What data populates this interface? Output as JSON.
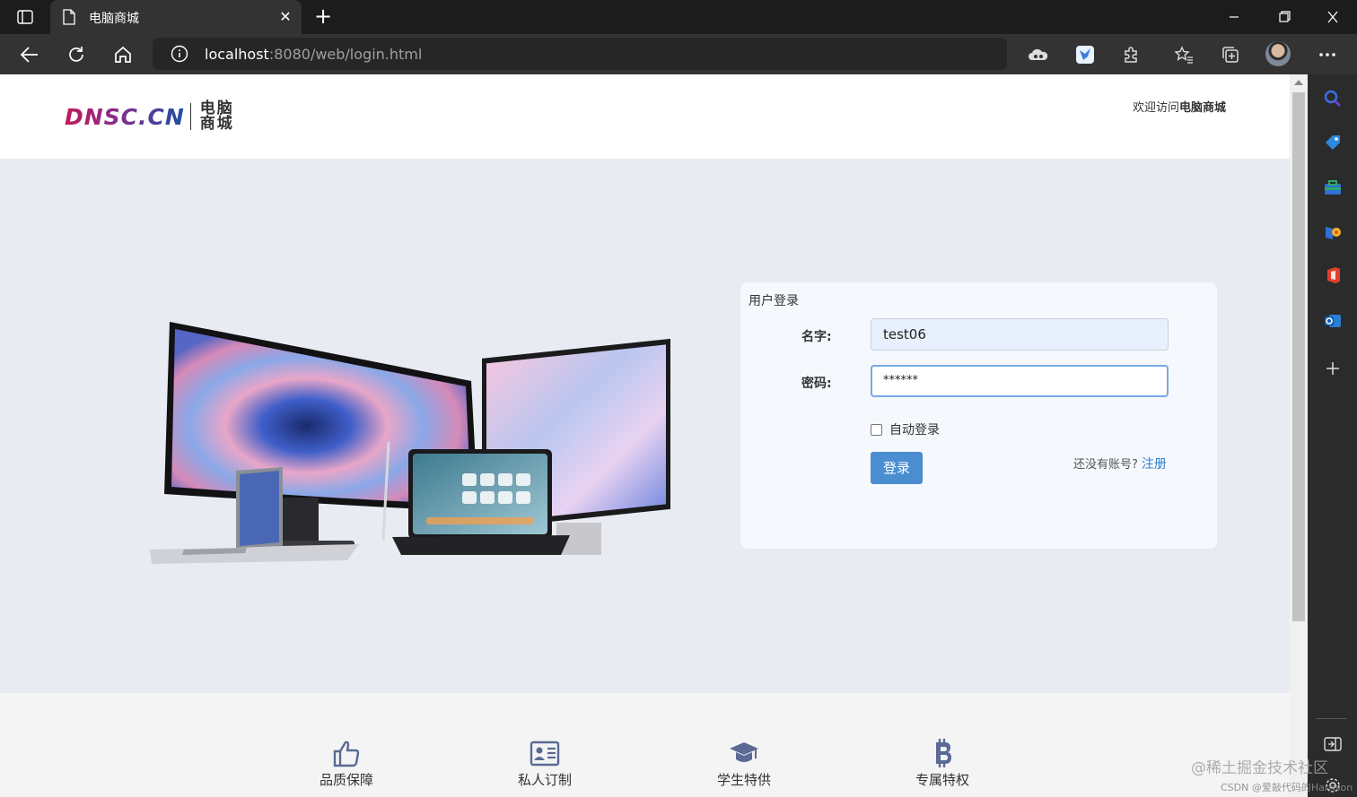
{
  "browser": {
    "tab_title": "电脑商城",
    "address_host": "localhost",
    "address_path": ":8080/web/login.html"
  },
  "header": {
    "logo_en": "DNSC.CN",
    "logo_cn": "电脑商城",
    "welcome_prefix": "欢迎访问",
    "welcome_name": "电脑商城"
  },
  "login": {
    "title": "用户登录",
    "username_label": "名字:",
    "username_value": "test06",
    "password_label": "密码:",
    "password_masked": "******",
    "remember_label": "自动登录",
    "login_button": "登录",
    "no_account_text": "还没有账号?",
    "register_link": "注册"
  },
  "features": [
    {
      "label": "品质保障",
      "icon": "thumbs-up-icon"
    },
    {
      "label": "私人订制",
      "icon": "id-card-icon"
    },
    {
      "label": "学生特供",
      "icon": "graduation-cap-icon"
    },
    {
      "label": "专属特权",
      "icon": "bitcoin-icon"
    }
  ],
  "watermark": {
    "main": "@稀土掘金技术社区",
    "sub": "CSDN @爱敲代码的Harrison"
  },
  "colors": {
    "accent": "#4a8ed1",
    "link": "#2f7fd0",
    "hero_bg": "#e8ecf2",
    "feature_icon": "#5a6a94"
  }
}
